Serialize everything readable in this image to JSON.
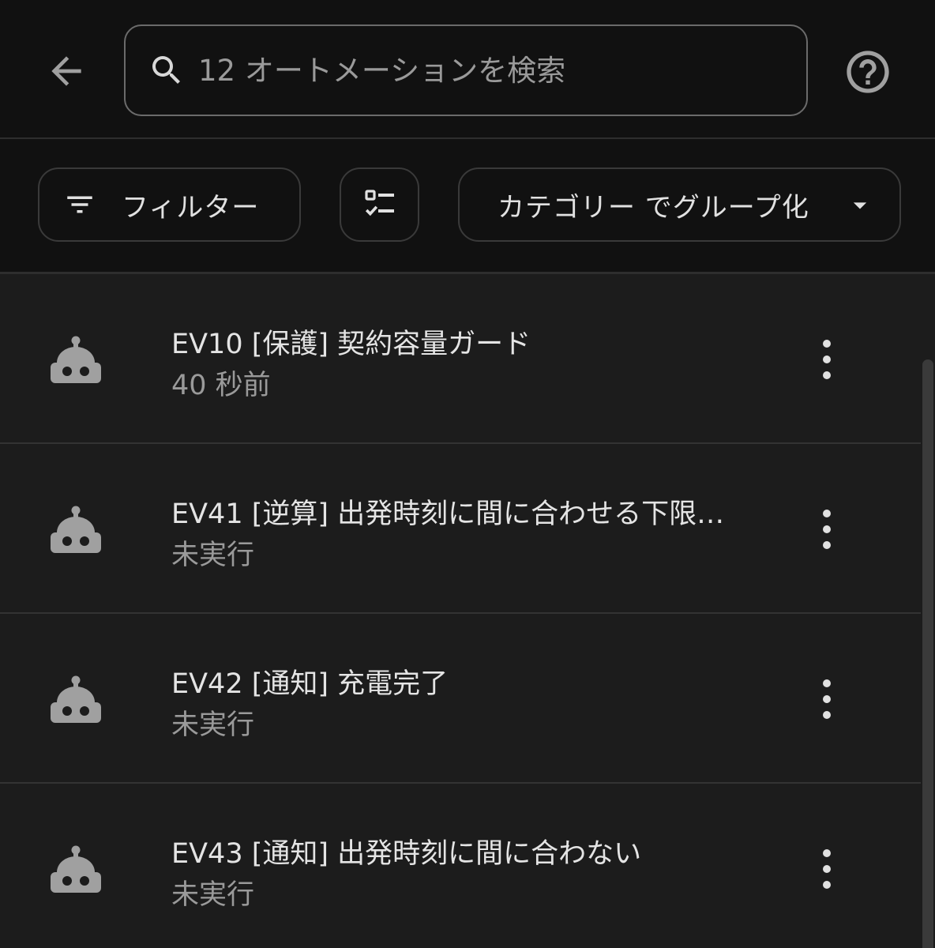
{
  "header": {
    "search_placeholder": "12 オートメーションを検索",
    "icons": {
      "back": "arrow-left-icon",
      "search": "search-icon",
      "help": "help-circle-icon"
    }
  },
  "toolbar": {
    "filter_label": "フィルター",
    "group_label": "カテゴリー でグループ化",
    "icons": {
      "filter": "filter-icon",
      "select": "checklist-icon",
      "dropdown": "caret-down-icon"
    }
  },
  "automations": [
    {
      "title": "EV10 [保護] 契約容量ガード",
      "subtitle": "40 秒前",
      "icon": "robot-icon"
    },
    {
      "title": "EV41 [逆算] 出発時刻に間に合わせる下限…",
      "subtitle": "未実行",
      "icon": "robot-icon"
    },
    {
      "title": "EV42 [通知] 充電完了",
      "subtitle": "未実行",
      "icon": "robot-icon"
    },
    {
      "title": "EV43 [通知] 出発時刻に間に合わない",
      "subtitle": "未実行",
      "icon": "robot-icon"
    }
  ],
  "colors": {
    "background": "#1c1c1c",
    "header_background": "#111111",
    "text_primary": "#e4e4e4",
    "text_secondary": "#9a9a9a",
    "icon": "#a0a0a0"
  }
}
